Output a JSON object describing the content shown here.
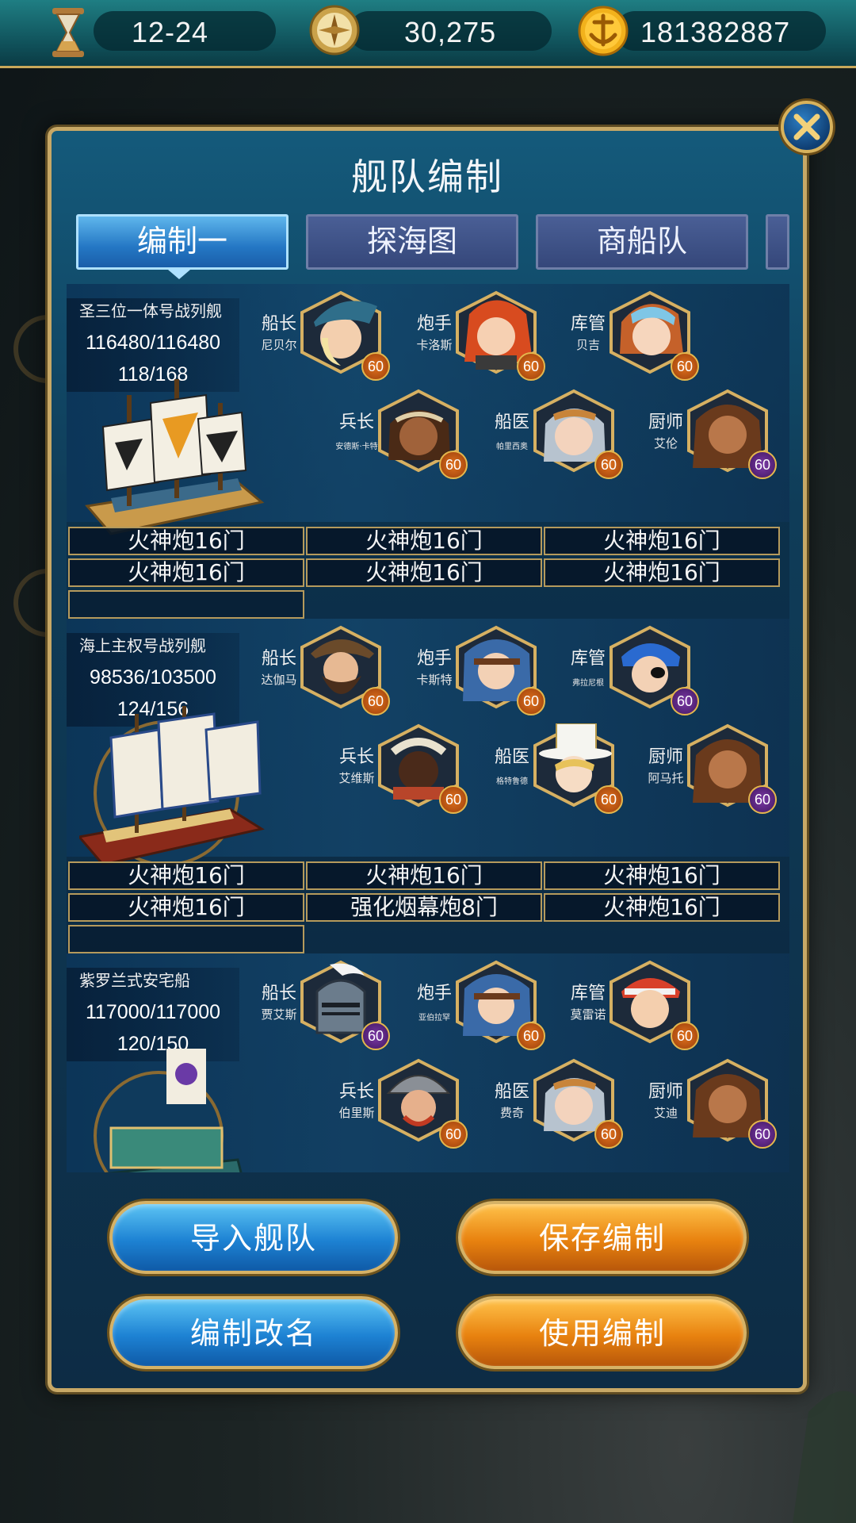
{
  "resources": [
    {
      "icon": "hourglass-icon",
      "value": "12-24"
    },
    {
      "icon": "compass-icon",
      "value": "30,275"
    },
    {
      "icon": "gold-anchor-coin-icon",
      "value": "181382887"
    }
  ],
  "panel": {
    "title": "舰队编制",
    "close_icon": "close-icon"
  },
  "tabs": [
    {
      "label": "编制一",
      "active": true
    },
    {
      "label": "探海图",
      "active": false
    },
    {
      "label": "商船队",
      "active": false
    }
  ],
  "ships": [
    {
      "name": "圣三位一体号战列舰",
      "durability": "116480/116480",
      "crew": "118/168",
      "crew_slots": [
        {
          "role": "船长",
          "name": "尼贝尔",
          "level": "60"
        },
        {
          "role": "炮手",
          "name": "卡洛斯",
          "level": "60"
        },
        {
          "role": "库管",
          "name": "贝吉",
          "level": "60"
        },
        {
          "role": "兵长",
          "name": "安德斯·卡特",
          "level": "60"
        },
        {
          "role": "船医",
          "name": "帕里西奥",
          "level": "60"
        },
        {
          "role": "厨师",
          "name": "艾伦",
          "level": "60"
        }
      ],
      "cannons": [
        "火神炮16门",
        "火神炮16门",
        "火神炮16门",
        "火神炮16门",
        "火神炮16门",
        "火神炮16门"
      ]
    },
    {
      "name": "海上主权号战列舰",
      "durability": "98536/103500",
      "crew": "124/156",
      "crew_slots": [
        {
          "role": "船长",
          "name": "达伽马",
          "level": "60"
        },
        {
          "role": "炮手",
          "name": "卡斯特",
          "level": "60"
        },
        {
          "role": "库管",
          "name": "弗拉尼根",
          "level": "60"
        },
        {
          "role": "兵长",
          "name": "艾维斯",
          "level": "60"
        },
        {
          "role": "船医",
          "name": "格特鲁德",
          "level": "60"
        },
        {
          "role": "厨师",
          "name": "阿马托",
          "level": "60"
        }
      ],
      "cannons": [
        "火神炮16门",
        "火神炮16门",
        "火神炮16门",
        "火神炮16门",
        "强化烟幕炮8门",
        "火神炮16门"
      ]
    },
    {
      "name": "紫罗兰式安宅船",
      "durability": "117000/117000",
      "crew": "120/150",
      "crew_slots": [
        {
          "role": "船长",
          "name": "贾艾斯",
          "level": "60"
        },
        {
          "role": "炮手",
          "name": "亚伯拉罕",
          "level": "60"
        },
        {
          "role": "库管",
          "name": "莫雷诺",
          "level": "60"
        },
        {
          "role": "兵长",
          "name": "伯里斯",
          "level": "60"
        },
        {
          "role": "船医",
          "name": "费奇",
          "level": "60"
        },
        {
          "role": "厨师",
          "name": "艾迪",
          "level": "60"
        }
      ],
      "cannons": []
    }
  ],
  "buttons": {
    "import": "导入舰队",
    "save": "保存编制",
    "rename": "编制改名",
    "use": "使用编制"
  },
  "colors": {
    "gold": "#c7a866",
    "tab_active": "#2477c4",
    "button_blue": "#1d82d3",
    "button_orange": "#e8820f"
  }
}
